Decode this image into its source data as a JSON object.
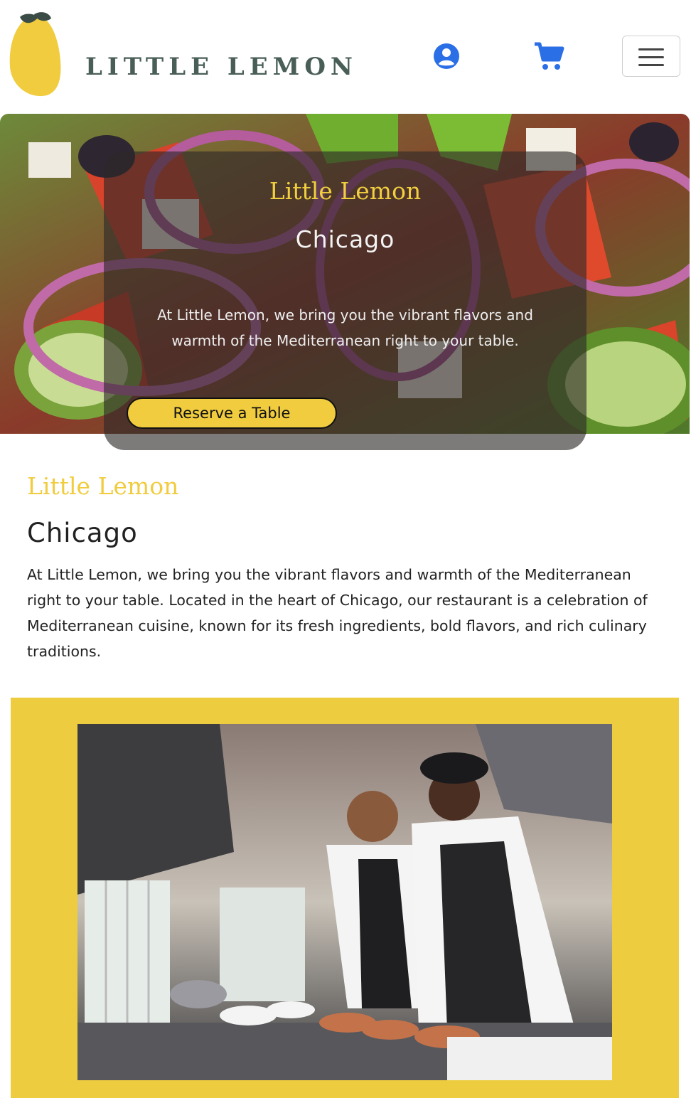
{
  "header": {
    "logo_text": "LITTLE LEMON",
    "icons": {
      "user": "user-circle-icon",
      "cart": "shopping-cart-icon",
      "menu": "hamburger-menu-icon"
    }
  },
  "hero": {
    "brand": "Little Lemon",
    "city": "Chicago",
    "description": "At Little Lemon, we bring you the vibrant flavors and warmth of the Mediterranean right to your table.",
    "reserve_label": "Reserve a Table"
  },
  "about": {
    "brand": "Little Lemon",
    "city": "Chicago",
    "text": "At Little Lemon, we bring you the vibrant flavors and warmth of the Mediterranean right to your table. Located in the heart of Chicago, our restaurant is a celebration of Mediterranean cuisine, known for its fresh ingredients, bold flavors, and rich culinary traditions."
  },
  "colors": {
    "primary_yellow": "#f0cc3e",
    "brand_green": "#495e57",
    "icon_blue": "#2b6fe6",
    "section_yellow": "#edcd3f"
  }
}
